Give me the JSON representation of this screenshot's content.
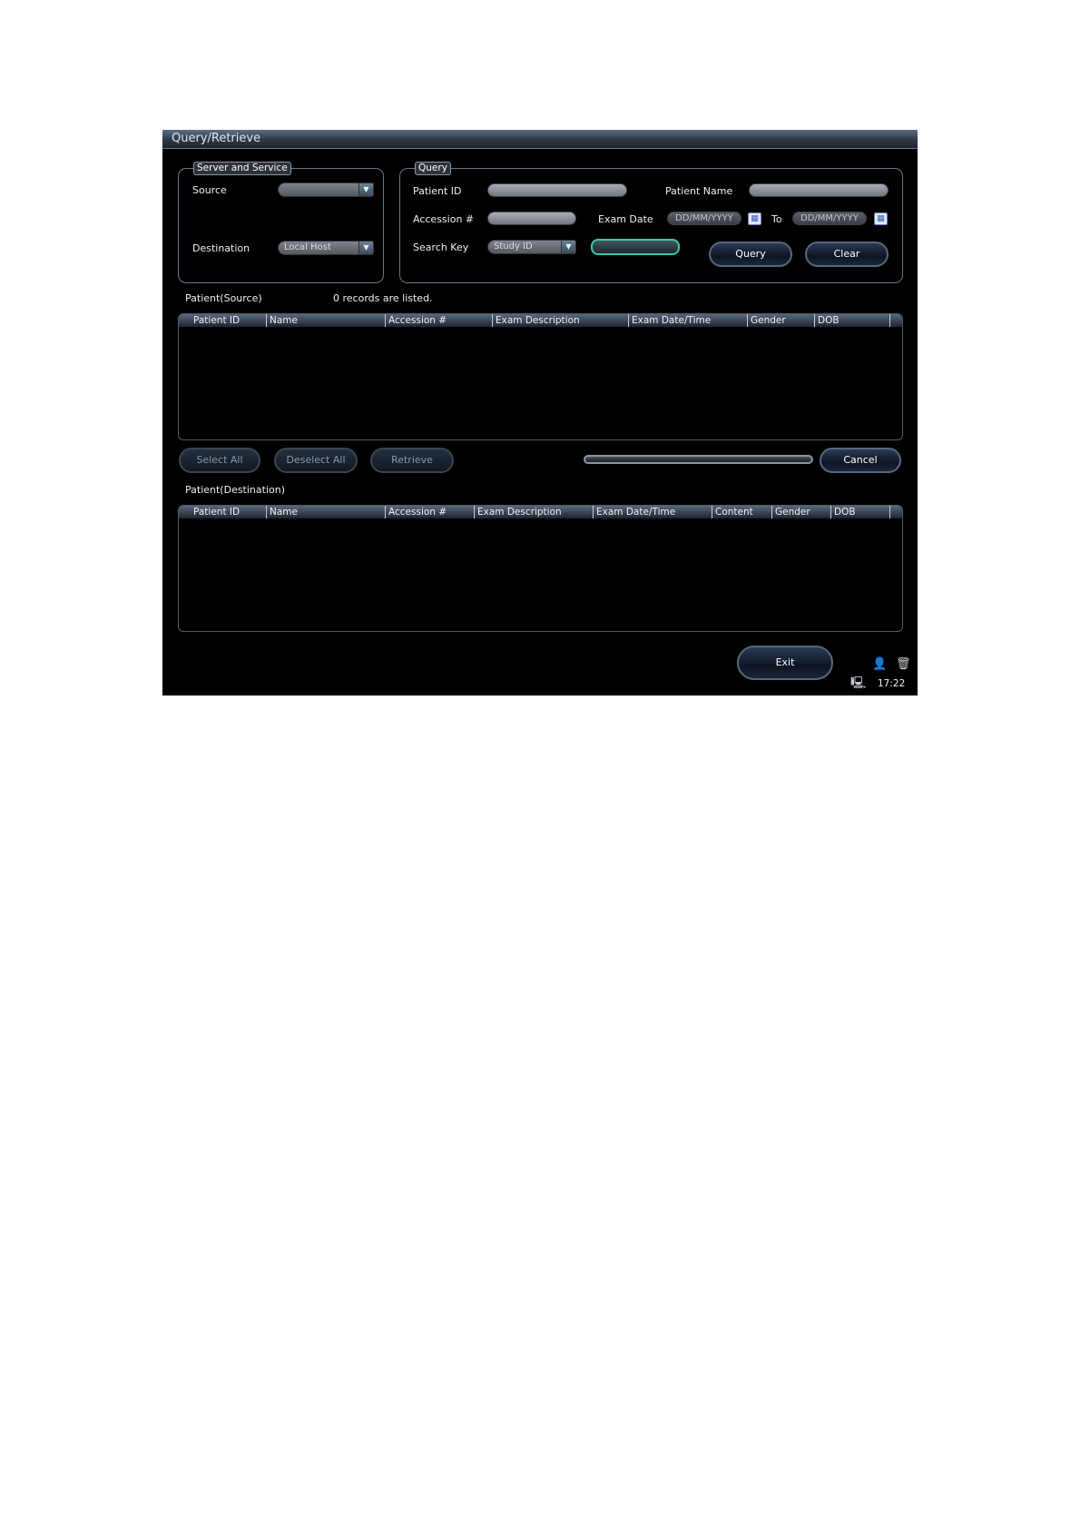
{
  "window": {
    "title": "Query/Retrieve"
  },
  "server_group": {
    "title": "Server and Service",
    "source_label": "Source",
    "source_value": "",
    "destination_label": "Destination",
    "destination_value": "Local Host"
  },
  "query_group": {
    "title": "Query",
    "patient_id_label": "Patient ID",
    "patient_id_value": "",
    "patient_name_label": "Patient Name",
    "patient_name_value": "",
    "accession_label": "Accession #",
    "accession_value": "",
    "exam_date_label": "Exam Date",
    "date_from_placeholder": "DD/MM/YYYY",
    "to_label": "To",
    "date_to_placeholder": "DD/MM/YYYY",
    "search_key_label": "Search Key",
    "search_key_value": "Study ID",
    "search_value": "",
    "query_button": "Query",
    "clear_button": "Clear"
  },
  "source_list": {
    "title": "Patient(Source)",
    "status": "0 records are listed.",
    "columns": [
      "Patient ID",
      "Name",
      "Accession #",
      "Exam Description",
      "Exam Date/Time",
      "Gender",
      "DOB"
    ]
  },
  "actions": {
    "select_all": "Select All",
    "deselect_all": "Deselect All",
    "retrieve": "Retrieve",
    "cancel": "Cancel",
    "progress": 0
  },
  "destination_list": {
    "title": "Patient(Destination)",
    "columns": [
      "Patient ID",
      "Name",
      "Accession #",
      "Exam Description",
      "Exam Date/Time",
      "Content",
      "Gender",
      "DOB"
    ]
  },
  "footer": {
    "exit_button": "Exit",
    "time": "17:22",
    "icons": [
      "user-icon",
      "trash-icon",
      "monitor-icon"
    ]
  }
}
